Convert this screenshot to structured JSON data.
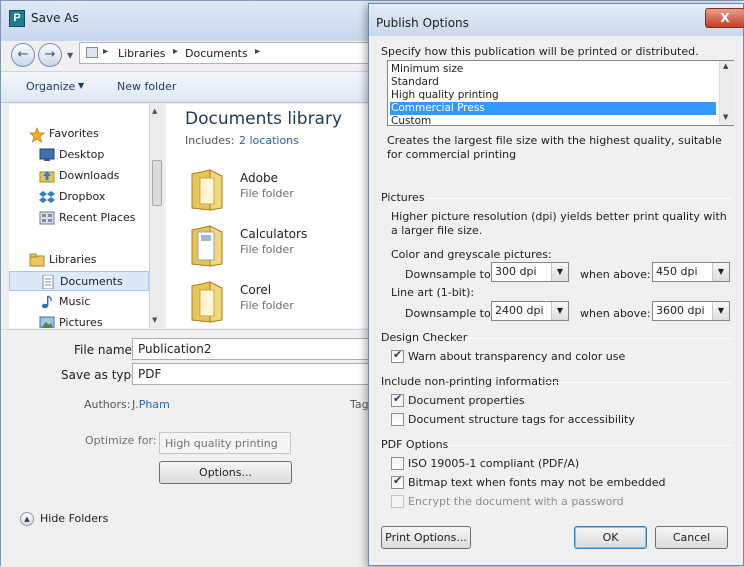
{
  "save_as": {
    "title": "Save As",
    "app_icon": "publisher-icon",
    "window_controls": {
      "minimize": "–",
      "maximize": "□",
      "close": "X"
    },
    "address": {
      "separator": "▸",
      "crumbs": [
        "Libraries",
        "Documents"
      ]
    },
    "toolbar": {
      "organize_label": "Organize",
      "organize_arrow": "▼",
      "new_folder_label": "New folder"
    },
    "nav_pane": {
      "items": [
        {
          "label": "Favorites",
          "icon": "star-icon"
        },
        {
          "label": "Desktop",
          "icon": "desktop-icon"
        },
        {
          "label": "Downloads",
          "icon": "downloads-icon"
        },
        {
          "label": "Dropbox",
          "icon": "dropbox-icon"
        },
        {
          "label": "Recent Places",
          "icon": "recent-places-icon"
        },
        {
          "label": "Libraries",
          "icon": "libraries-icon"
        },
        {
          "label": "Documents",
          "icon": "documents-icon",
          "selected": true
        },
        {
          "label": "Music",
          "icon": "music-icon"
        },
        {
          "label": "Pictures",
          "icon": "pictures-icon"
        }
      ]
    },
    "library": {
      "title": "Documents library",
      "includes_label": "Includes:",
      "includes_link": "2 locations",
      "folders": [
        {
          "name": "Adobe",
          "type": "File folder"
        },
        {
          "name": "Calculators",
          "type": "File folder"
        },
        {
          "name": "Corel",
          "type": "File folder"
        }
      ]
    },
    "form": {
      "file_name_label": "File name:",
      "file_name_value": "Publication2",
      "save_as_type_label": "Save as type:",
      "save_as_type_value": "PDF",
      "authors_label": "Authors:",
      "authors_value": "J.Pham",
      "tags_label": "Tag",
      "optimize_label": "Optimize for:",
      "optimize_value": "High quality printing",
      "options_button": "Options...",
      "hide_folders_label": "Hide Folders"
    }
  },
  "publish_options": {
    "title": "Publish Options",
    "close_glyph": "X",
    "specify_label": "Specify how this publication will be printed or distributed.",
    "options": [
      {
        "label": "Minimum size"
      },
      {
        "label": "Standard"
      },
      {
        "label": "High quality printing"
      },
      {
        "label": "Commercial Press",
        "selected": true
      },
      {
        "label": "Custom"
      }
    ],
    "selected_description": "Creates the largest file size with the highest quality, suitable for commercial printing",
    "pictures": {
      "section_title": "Pictures",
      "description": "Higher picture resolution (dpi) yields better print quality with a larger file size.",
      "color_label": "Color and greyscale pictures:",
      "color_downsample_label": "Downsample to:",
      "color_downsample_value": "300 dpi",
      "color_above_label": "when above:",
      "color_above_value": "450 dpi",
      "lineart_label": "Line art (1-bit):",
      "lineart_downsample_label": "Downsample to:",
      "lineart_downsample_value": "2400 dpi",
      "lineart_above_label": "when above:",
      "lineart_above_value": "3600 dpi",
      "dropdown_arrow": "▼"
    },
    "design_checker": {
      "section_title": "Design Checker",
      "warn_transparency": {
        "label": "Warn about transparency and color use",
        "checked": true
      }
    },
    "nonprinting": {
      "section_title": "Include non-printing information",
      "document_properties": {
        "label": "Document properties",
        "checked": true
      },
      "structure_tags": {
        "label": "Document structure tags for accessibility",
        "checked": false
      }
    },
    "pdf_options": {
      "section_title": "PDF Options",
      "iso_compliant": {
        "label": "ISO 19005-1 compliant (PDF/A)",
        "checked": false
      },
      "bitmap_text": {
        "label": "Bitmap text when fonts may not be embedded",
        "checked": true
      },
      "encrypt": {
        "label": "Encrypt the document with a password",
        "checked": false,
        "disabled": true
      }
    },
    "buttons": {
      "print_options": "Print Options...",
      "ok": "OK",
      "cancel": "Cancel"
    }
  }
}
